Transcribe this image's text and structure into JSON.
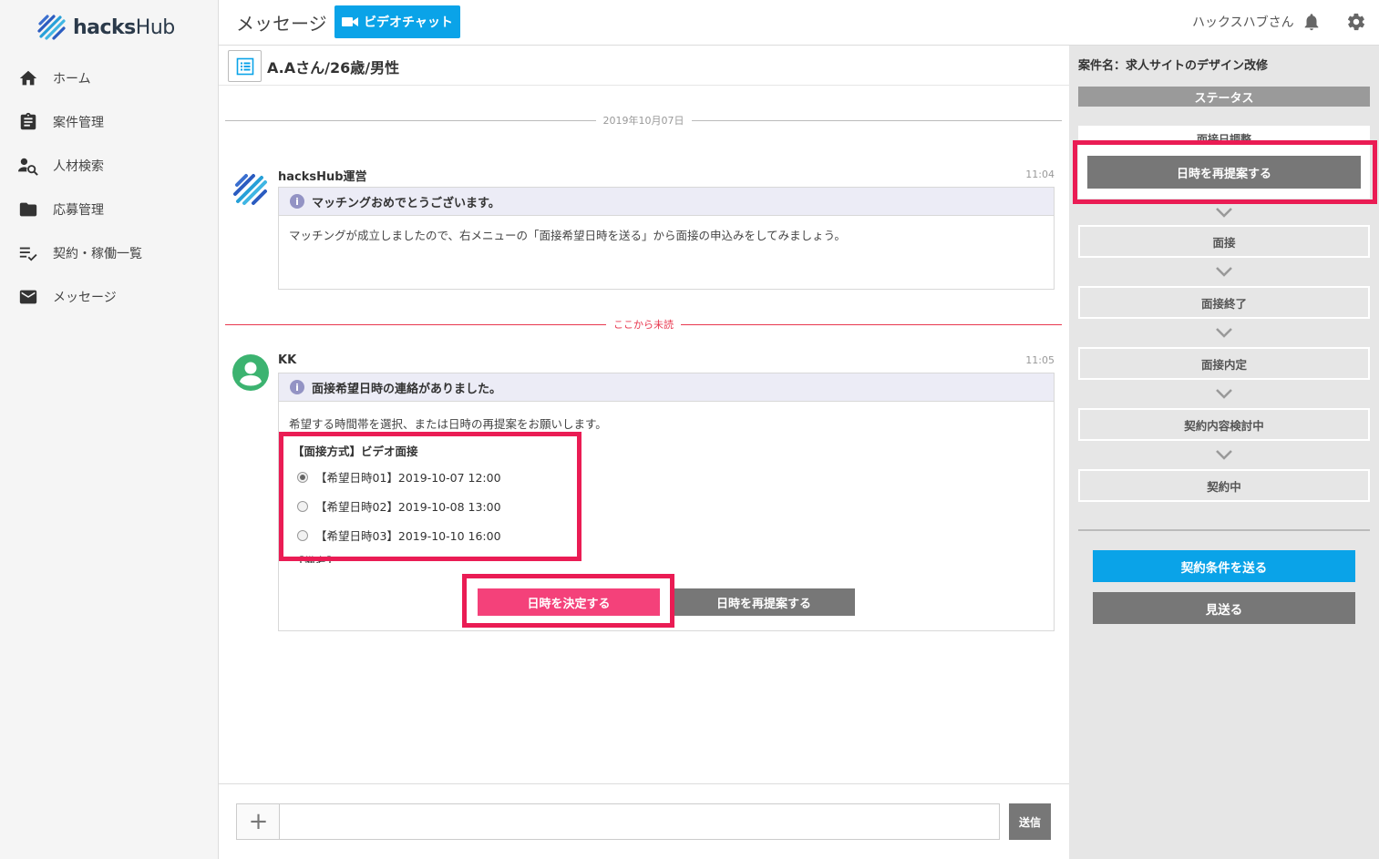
{
  "app": {
    "logo_bold": "hacks",
    "logo_light": "Hub"
  },
  "sidebar": {
    "items": [
      {
        "label": "ホーム",
        "icon": "home-icon"
      },
      {
        "label": "案件管理",
        "icon": "clipboard-icon"
      },
      {
        "label": "人材検索",
        "icon": "person-search-icon"
      },
      {
        "label": "応募管理",
        "icon": "folder-icon"
      },
      {
        "label": "契約・稼働一覧",
        "icon": "checklist-icon"
      },
      {
        "label": "メッセージ",
        "icon": "mail-icon"
      }
    ]
  },
  "header": {
    "title": "メッセージ",
    "video_chat_label": "ビデオチャット",
    "user_name": "ハックスハブさん"
  },
  "chat": {
    "candidate": "A.Aさん/26歳/男性",
    "date_divider": "2019年10月07日",
    "unread_divider": "ここから未読",
    "messages": [
      {
        "sender": "hacksHub運営",
        "time": "11:04",
        "header": "マッチングおめでとうございます。",
        "body": "マッチングが成立しましたので、右メニューの「面接希望日時を送る」から面接の申込みをしてみましょう。"
      },
      {
        "sender": "KK",
        "time": "11:05",
        "header": "面接希望日時の連絡がありました。",
        "body": "希望する時間帯を選択、または日時の再提案をお願いします。",
        "method": "【面接方式】ビデオ面接",
        "options": [
          {
            "label": "【希望日時01】2019-10-07 12:00",
            "selected": true
          },
          {
            "label": "【希望日時02】2019-10-08 13:00",
            "selected": false
          },
          {
            "label": "【希望日時03】2019-10-10 16:00",
            "selected": false
          }
        ],
        "remarks": "【備考】",
        "decide_label": "日時を決定する",
        "repropose_label": "日時を再提案する"
      }
    ],
    "composer": {
      "plus_label": "+",
      "input_value": "",
      "send_label": "送信"
    }
  },
  "right_panel": {
    "project": "案件名：求人サイトのデザイン改修",
    "status_title": "ステータス",
    "steps": [
      "面接日調整",
      "面接",
      "面接終了",
      "面接内定",
      "契約内容検討中",
      "契約中"
    ],
    "repropose_label": "日時を再提案する",
    "send_contract_label": "契約条件を送る",
    "pass_label": "見送る"
  },
  "colors": {
    "accent_blue": "#0aa3e8",
    "accent_pink": "#f4417a",
    "highlight_red": "#ea1c54",
    "button_gray": "#777777"
  }
}
